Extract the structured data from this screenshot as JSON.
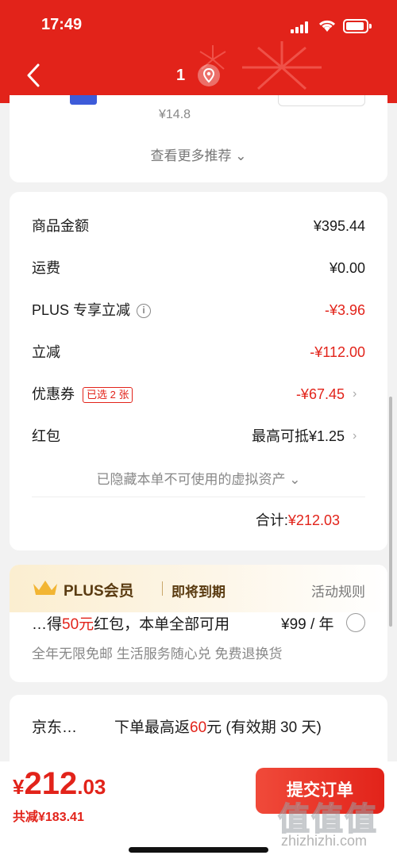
{
  "status_bar": {
    "time": "17:49"
  },
  "nav": {
    "title": "1"
  },
  "recommend": {
    "price": "¥14.8",
    "more_label": "查看更多推荐 ⌄"
  },
  "summary": {
    "rows": [
      {
        "label": "商品金额",
        "value": "¥395.44"
      },
      {
        "label": "运费",
        "value": "¥0.00"
      },
      {
        "label": "PLUS 专享立减",
        "value": "-¥3.96"
      },
      {
        "label": "立减",
        "value": "-¥112.00"
      },
      {
        "label": "优惠券",
        "tag": "已选 2 张",
        "value": "-¥67.45"
      },
      {
        "label": "红包",
        "value": "最高可抵¥1.25"
      }
    ],
    "hidden_assets": "已隐藏本单不可使用的虚拟资产 ⌄",
    "total_label": "合计:",
    "total_value": "¥212.03"
  },
  "plus": {
    "title": "PLUS会员",
    "status": "即将到期",
    "rules": "活动规则",
    "offer_prefix": "…得",
    "offer_highlight": "50元",
    "offer_suffix": "红包，本单全部可用",
    "price": "¥99 / 年",
    "benefits": "全年无限免邮 生活服务随心兑 免费退换货"
  },
  "jd": {
    "label": "京东…",
    "offer_prefix": "下单最高返",
    "offer_highlight": "60",
    "offer_suffix": "元 (有效期 30 天)"
  },
  "bottom": {
    "yen": "¥",
    "total_int": "212",
    "total_dec": ".03",
    "saved": "共减¥183.41",
    "submit": "提交订单"
  },
  "watermark": {
    "chars": "值值值",
    "url": "zhizhizhi.com"
  },
  "colors": {
    "brand_red": "#e2231a",
    "plus_gold": "#5a3b11"
  }
}
